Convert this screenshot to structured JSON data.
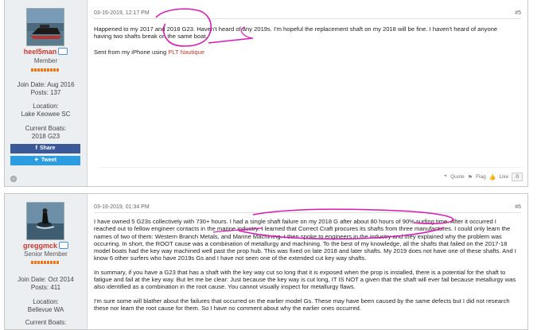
{
  "posts": [
    {
      "user": {
        "name": "heel5man",
        "rank": "Member",
        "join_label": "Join Date:",
        "join": "Aug 2016",
        "posts_label": "Posts:",
        "posts": "137",
        "location_label": "Location:",
        "location": "Lake Keowee SC",
        "boats_label": "Current Boats:",
        "boats": "2018 G23"
      },
      "date": "03-16-2019, 12:17 PM",
      "number": "#5",
      "p1": "Happened to my 2017 and 2018 G23. Haven't heard of any 2019s. I'm hopeful the replacement shaft on my 2018 will be fine. I haven't heard of anyone having two shafts break on the same boat.",
      "p2_prefix": "Sent from my iPhone using ",
      "p2_link": "PLT Nautique",
      "share_label": "Share",
      "tweet_label": "Tweet",
      "quote_label": "Quote",
      "flag_label": "Flag",
      "like_label": "Like",
      "like_count": "0"
    },
    {
      "user": {
        "name": "greggmck",
        "rank": "Senior Member",
        "join_label": "Join Date:",
        "join": "Oct 2014",
        "posts_label": "Posts:",
        "posts": "411",
        "location_label": "Location:",
        "location": "Bellevue WA",
        "boats_label": "Current Boats:"
      },
      "date": "03-16-2019, 01:34 PM",
      "number": "#6",
      "p1": "I have owned 5 G23s collectively with 730+ hours. I had a single shaft failure on my 2018 G after about 80 hours of 90% surfing time. After it occurred I reached out to fellow engineer contacts in the marine industry. I learned that Correct Craft procures its shafts from three manufactures. I could only learn the names of two of them: Western Branch Metals, and Marine Machining. I then spoke to engineers in the industry and they explained why the problem was occurring. In short, the ROOT cause was a combination of metallurgy and machining. To the best of my knowledge, all the shafts that failed on the 2017-18 model boats had the key way machined well past the prop hub. This was fixed on late 2018 and later shafts. My 2019 does not have one of these shafts. And I know 6 other surfers who have 2019s Gs and I have not seen one of the extended cut key way shafts.",
      "p2": "In summary, if you have a G23 that has a shaft with the key way cut so long that it is exposed when the prop is installed, there is a potential for the shaft to fatigue and fail at the key way. But let me be clear: Just because the key way is cut long, IT IS NOT a given that the shaft will ever fail because metallurgy was also identified as a combination in the root cause. You cannot visually inspect for metallurgy flaws.",
      "p3": "I'm sure some will blather about the failures that occurred on the earlier model Gs. These may have been caused by the same defects but I did not research these nor learn the root cause for them. So I have no comment about why the earlier ones occurred."
    }
  ],
  "colors": {
    "username": "#c63a32",
    "annotation": "#d81bb4",
    "facebook": "#3b5998",
    "twitter": "#2c9ee0"
  }
}
